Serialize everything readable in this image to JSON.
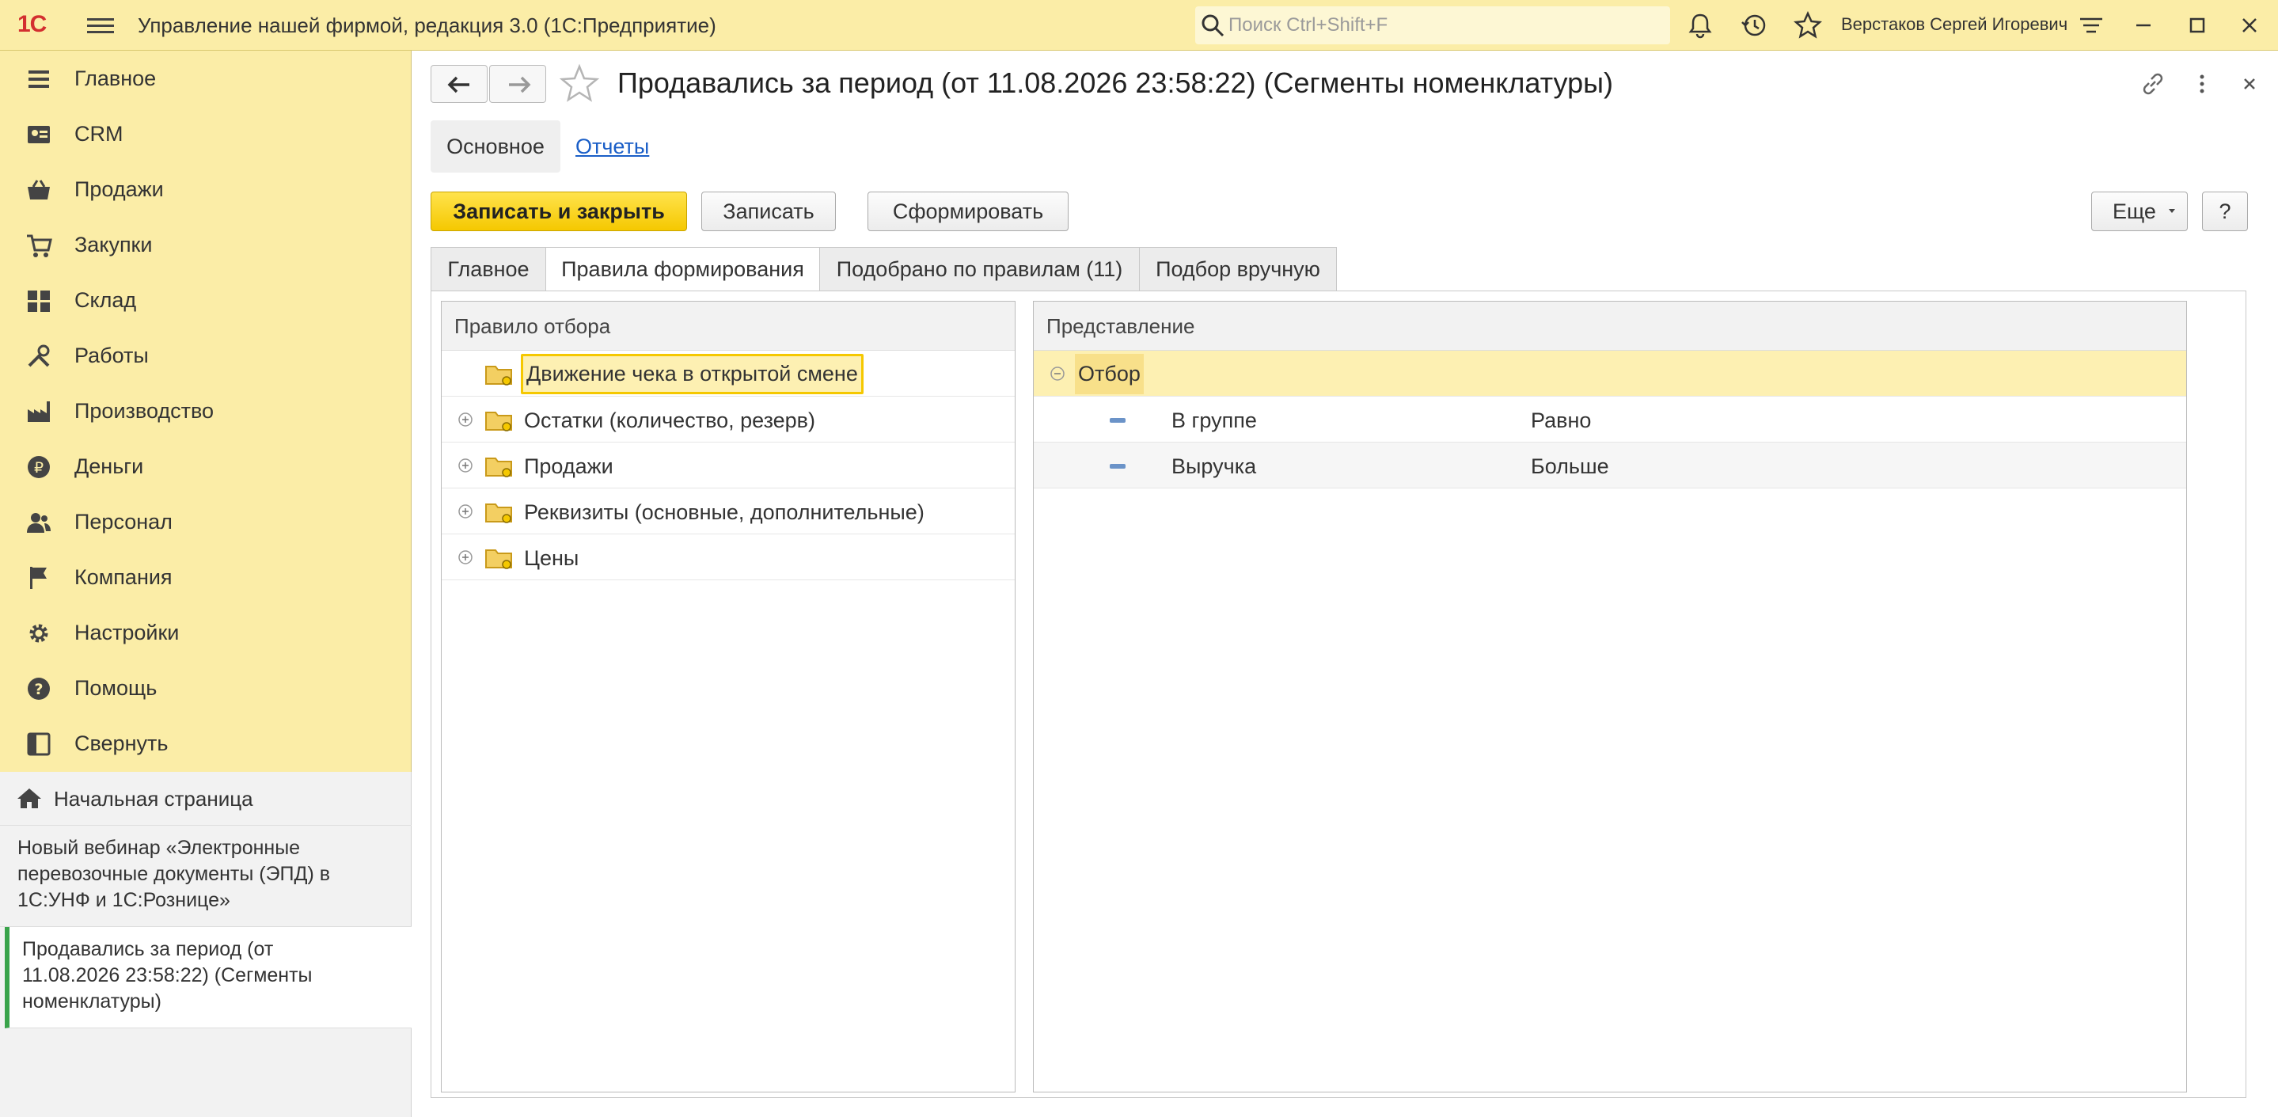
{
  "app": {
    "logo": "1С",
    "title": "Управление нашей фирмой, редакция 3.0  (1С:Предприятие)",
    "search_placeholder": "Поиск Ctrl+Shift+F",
    "user": "Верстаков Сергей Игоревич"
  },
  "sidebar": {
    "items": [
      {
        "label": "Главное",
        "icon": "menu-lines-icon"
      },
      {
        "label": "CRM",
        "icon": "contact-card-icon"
      },
      {
        "label": "Продажи",
        "icon": "basket-icon"
      },
      {
        "label": "Закупки",
        "icon": "cart-icon"
      },
      {
        "label": "Склад",
        "icon": "warehouse-grid-icon"
      },
      {
        "label": "Работы",
        "icon": "tools-icon"
      },
      {
        "label": "Производство",
        "icon": "factory-icon"
      },
      {
        "label": "Деньги",
        "icon": "ruble-coin-icon"
      },
      {
        "label": "Персонал",
        "icon": "people-icon"
      },
      {
        "label": "Компания",
        "icon": "flag-icon"
      },
      {
        "label": "Настройки",
        "icon": "gear-icon"
      },
      {
        "label": "Помощь",
        "icon": "help-circle-icon"
      },
      {
        "label": "Свернуть",
        "icon": "collapse-panel-icon"
      }
    ]
  },
  "open_windows": {
    "home": "Начальная страница",
    "items": [
      {
        "text": "Новый вебинар «Электронные\nперевозочные документы (ЭПД) в\n1С:УНФ и 1С:Рознице»"
      },
      {
        "text": "Продавались за период (от\n11.08.2026 23:58:22) (Сегменты\nноменклатуры)"
      }
    ]
  },
  "form": {
    "title": "Продавались за период (от 11.08.2026 23:58:22) (Сегменты номенклатуры)",
    "sections": {
      "main": "Основное",
      "reports": "Отчеты"
    },
    "buttons": {
      "save_close": "Записать и закрыть",
      "save": "Записать",
      "generate": "Сформировать",
      "more": "Еще",
      "help": "?"
    },
    "tabs": [
      "Главное",
      "Правила формирования",
      "Подобрано по правилам (11)",
      "Подбор вручную"
    ],
    "active_tab": "Правила формирования",
    "rules_header": "Правило отбора",
    "rules": [
      {
        "label": "Движение чека в открытой смене",
        "selected": true,
        "expandable": false
      },
      {
        "label": "Остатки (количество, резерв)",
        "selected": false,
        "expandable": true
      },
      {
        "label": "Продажи",
        "selected": false,
        "expandable": true
      },
      {
        "label": "Реквизиты (основные, дополнительные)",
        "selected": false,
        "expandable": true
      },
      {
        "label": "Цены",
        "selected": false,
        "expandable": true
      }
    ],
    "representation_header": "Представление",
    "filter_group": "Отбор",
    "filter_rows": [
      {
        "field": "В группе",
        "condition": "Равно"
      },
      {
        "field": "Выручка",
        "condition": "Больше"
      }
    ]
  },
  "colors": {
    "accent": "#f5c800",
    "panel": "#fbeda7",
    "link": "#1a5ec7",
    "logo": "#d32f2f"
  }
}
